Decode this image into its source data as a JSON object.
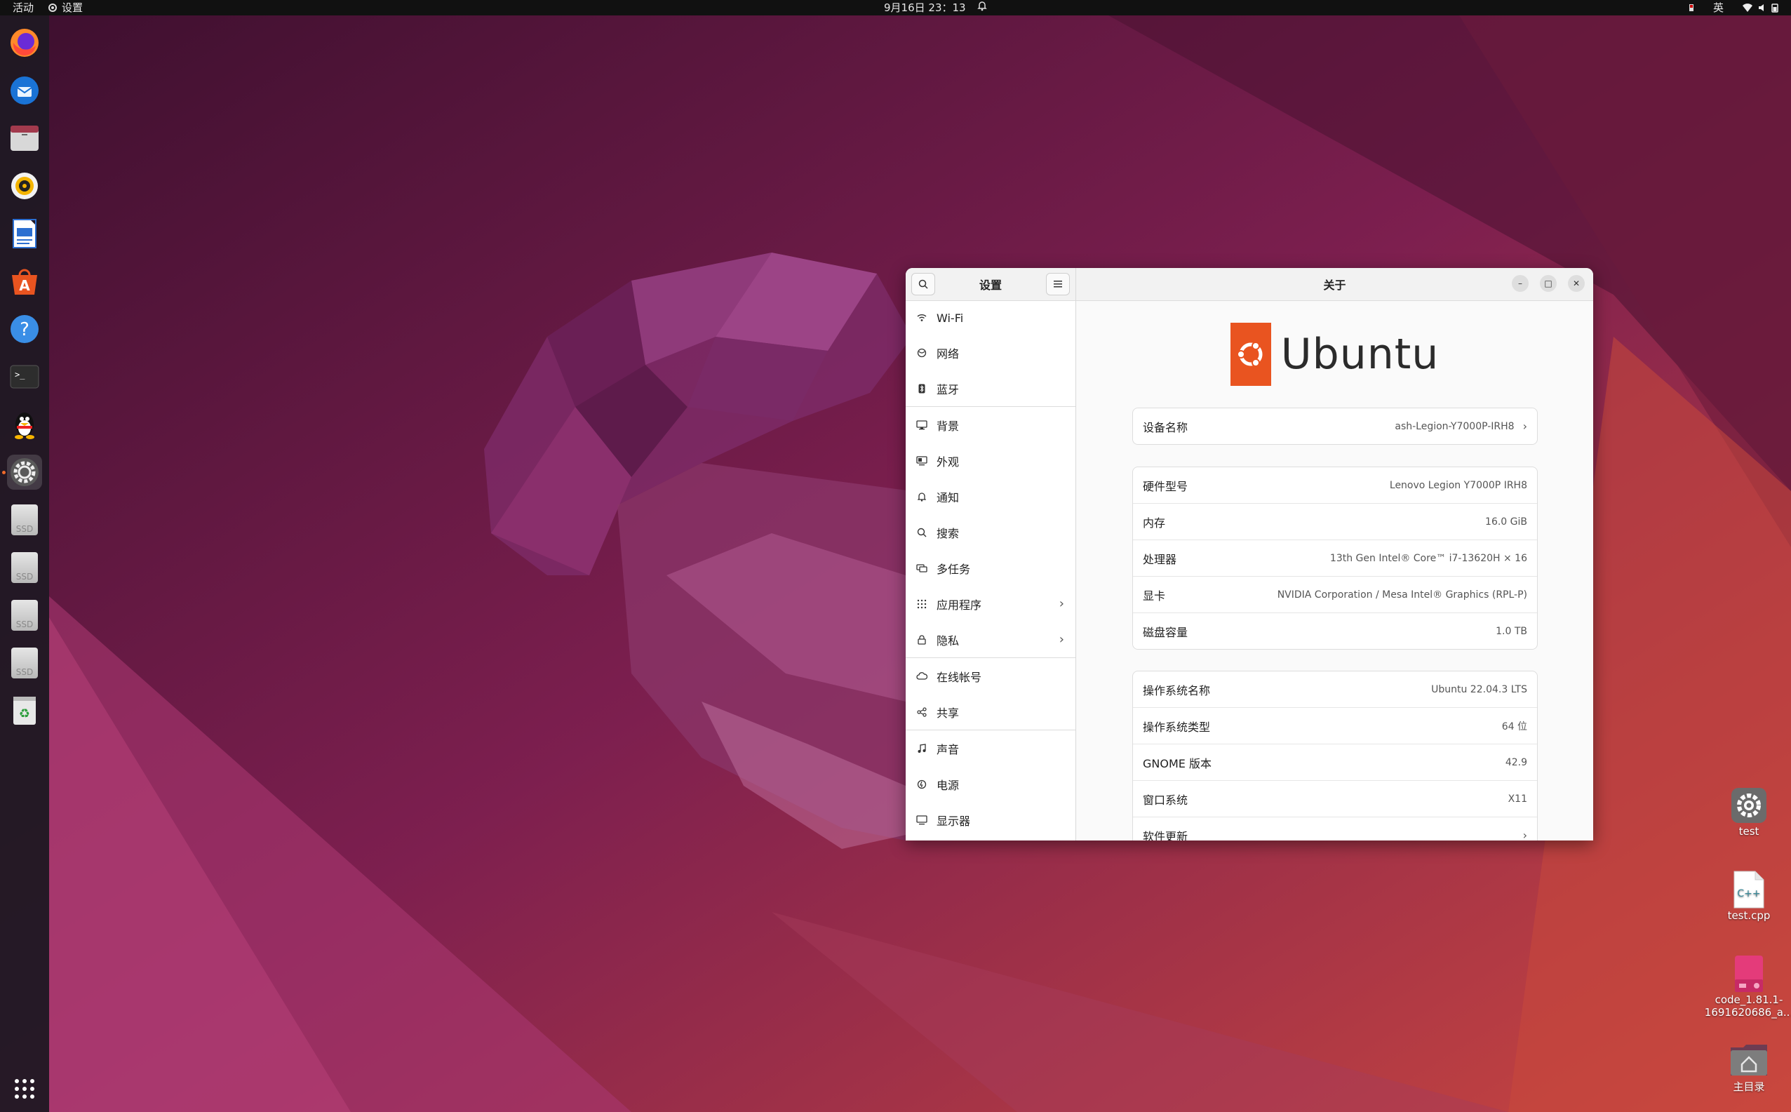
{
  "topbar": {
    "activities": "活动",
    "app_menu": "设置",
    "clock": "9月16日 23：13",
    "input_method": "英"
  },
  "dock": {
    "items": [
      {
        "name": "Firefox",
        "icon": "firefox-icon"
      },
      {
        "name": "Thunderbird",
        "icon": "thunderbird-icon"
      },
      {
        "name": "Files",
        "icon": "files-icon"
      },
      {
        "name": "Rhythmbox",
        "icon": "rhythmbox-icon"
      },
      {
        "name": "LibreOffice Writer",
        "icon": "writer-icon"
      },
      {
        "name": "Ubuntu Software",
        "icon": "software-icon"
      },
      {
        "name": "Help",
        "icon": "help-icon"
      },
      {
        "name": "Terminal",
        "icon": "terminal-icon"
      },
      {
        "name": "QQ",
        "icon": "qq-icon"
      },
      {
        "name": "Settings",
        "icon": "settings-icon"
      },
      {
        "name": "SSD",
        "icon": "ssd-icon"
      },
      {
        "name": "SSD",
        "icon": "ssd-icon"
      },
      {
        "name": "SSD",
        "icon": "ssd-icon"
      },
      {
        "name": "SSD",
        "icon": "ssd-icon"
      },
      {
        "name": "Trash",
        "icon": "trash-icon"
      }
    ],
    "ssd_label": "SSD"
  },
  "settings": {
    "sidebar_title": "设置",
    "nav": [
      {
        "label": "Wi-Fi",
        "icon": "wifi-icon"
      },
      {
        "label": "网络",
        "icon": "network-icon"
      },
      {
        "label": "蓝牙",
        "icon": "bluetooth-icon"
      },
      {
        "label": "背景",
        "icon": "background-icon"
      },
      {
        "label": "外观",
        "icon": "appearance-icon"
      },
      {
        "label": "通知",
        "icon": "bell-icon"
      },
      {
        "label": "搜索",
        "icon": "search-icon"
      },
      {
        "label": "多任务",
        "icon": "multitask-icon"
      },
      {
        "label": "应用程序",
        "icon": "apps-icon"
      },
      {
        "label": "隐私",
        "icon": "lock-icon"
      },
      {
        "label": "在线帐号",
        "icon": "cloud-icon"
      },
      {
        "label": "共享",
        "icon": "share-icon"
      },
      {
        "label": "声音",
        "icon": "music-icon"
      },
      {
        "label": "电源",
        "icon": "power-icon"
      },
      {
        "label": "显示器",
        "icon": "display-icon"
      }
    ],
    "page_title": "关于",
    "logo_text": "Ubuntu",
    "device": {
      "label": "设备名称",
      "value": "ash-Legion-Y7000P-IRH8"
    },
    "hardware": [
      {
        "label": "硬件型号",
        "value": "Lenovo Legion Y7000P IRH8"
      },
      {
        "label": "内存",
        "value": "16.0 GiB"
      },
      {
        "label": "处理器",
        "value": "13th Gen Intel® Core™ i7-13620H × 16"
      },
      {
        "label": "显卡",
        "value": "NVIDIA Corporation / Mesa Intel® Graphics (RPL-P)"
      },
      {
        "label": "磁盘容量",
        "value": "1.0 TB"
      }
    ],
    "os": [
      {
        "label": "操作系统名称",
        "value": "Ubuntu 22.04.3 LTS"
      },
      {
        "label": "操作系统类型",
        "value": "64 位"
      },
      {
        "label": "GNOME 版本",
        "value": "42.9"
      },
      {
        "label": "窗口系统",
        "value": "X11"
      },
      {
        "label": "软件更新",
        "value": ""
      }
    ]
  },
  "desktop": {
    "icons": [
      {
        "label": "test",
        "icon": "settings-icon"
      },
      {
        "label": "test.cpp",
        "icon": "cpp-file-icon"
      },
      {
        "label": "code_1.81.1-1691620686_a...",
        "icon": "package-icon"
      },
      {
        "label": "主目录",
        "icon": "home-folder-icon"
      }
    ]
  },
  "colors": {
    "accent": "#E95420",
    "topbar": "#111111",
    "dock": "#1e1923"
  }
}
